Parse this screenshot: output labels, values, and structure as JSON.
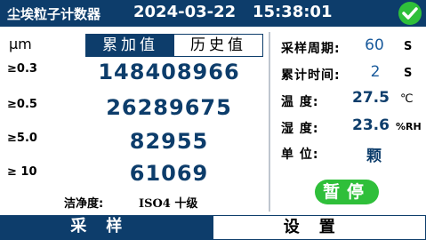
{
  "header": {
    "title": "尘埃粒子计数器",
    "datetime": "2024-03-22   15:38:01",
    "status_icon": "check-icon"
  },
  "counter": {
    "unit": "μm",
    "tabs": [
      {
        "label": "累加值",
        "active": true
      },
      {
        "label": "历史值",
        "active": false
      }
    ],
    "rows": [
      {
        "size": "≥0.3",
        "count": "148408966"
      },
      {
        "size": "≥0.5",
        "count": "26289675"
      },
      {
        "size": "≥5.0",
        "count": "82955"
      },
      {
        "size": "≥ 10",
        "count": "61069"
      }
    ],
    "cleanliness_label": "洁净度:",
    "cleanliness_value": "ISO4 十级"
  },
  "params": {
    "sample_period_label": "采样周期:",
    "sample_period_value": "60",
    "sample_period_unit": "S",
    "cumulative_time_label": "累计时间:",
    "cumulative_time_value": "2",
    "cumulative_time_unit": "S",
    "temperature_label": "温  度:",
    "temperature_value": "27.5",
    "temperature_unit": "℃",
    "humidity_label": "湿  度:",
    "humidity_value": "23.6",
    "humidity_unit": "%RH",
    "unit_label": "单  位:",
    "unit_value": "颗",
    "pause_label": "暂停"
  },
  "bottom_tabs": [
    {
      "label": "采样",
      "active": true
    },
    {
      "label": "设置",
      "active": false
    }
  ],
  "colors": {
    "primary": "#0d3d6b",
    "accent_green": "#2fbf3a",
    "value_blue": "#1a5b9c"
  }
}
